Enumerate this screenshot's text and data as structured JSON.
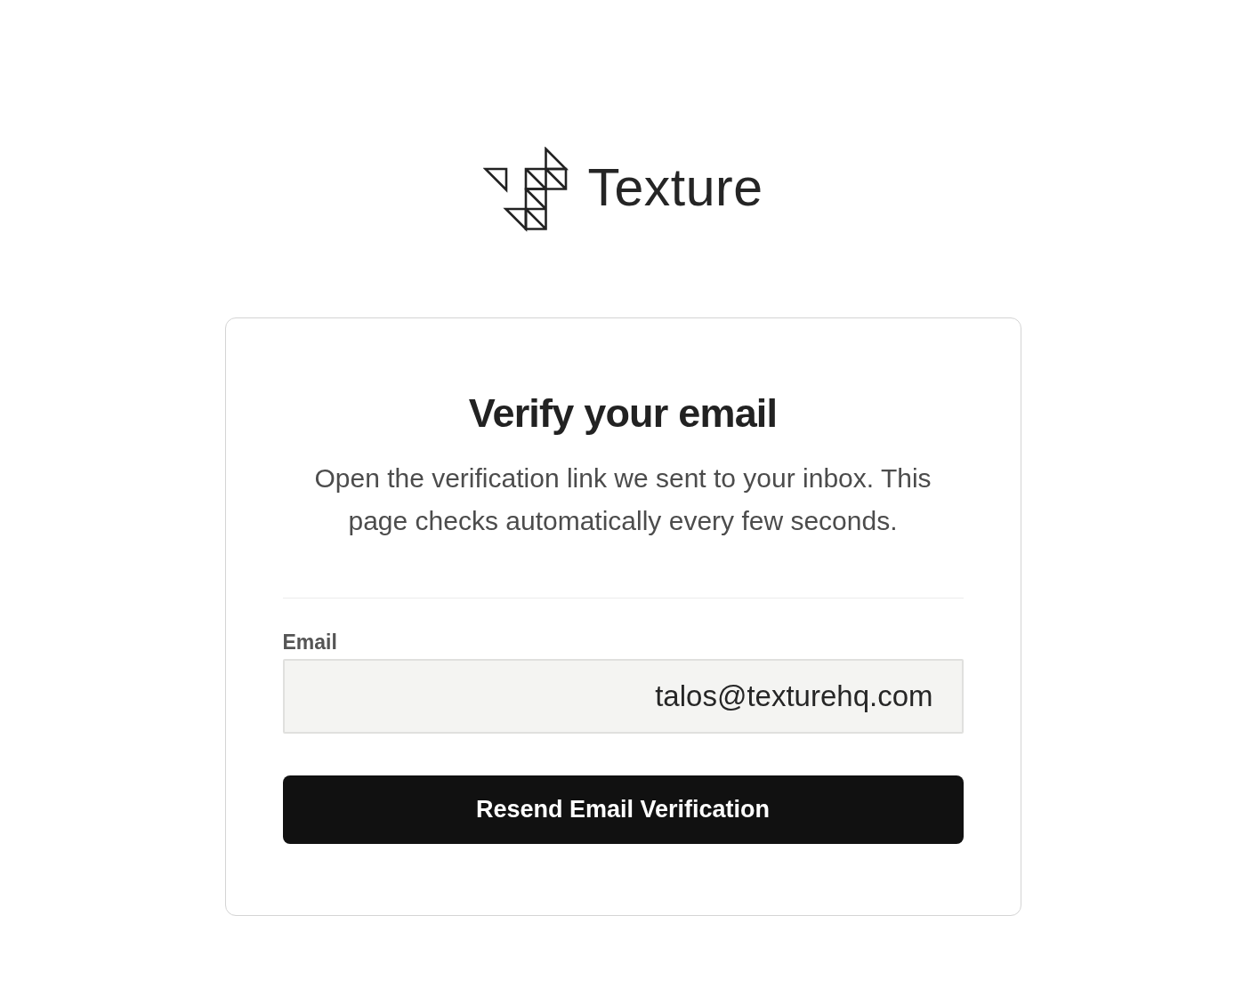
{
  "logo": {
    "wordmark": "Texture"
  },
  "card": {
    "title": "Verify your email",
    "message": "Open the verification link we sent to your inbox. This page checks automatically every few seconds.",
    "email_field": {
      "label": "Email",
      "value": "talos@texturehq.com"
    },
    "button": "Resend Email Verification"
  }
}
